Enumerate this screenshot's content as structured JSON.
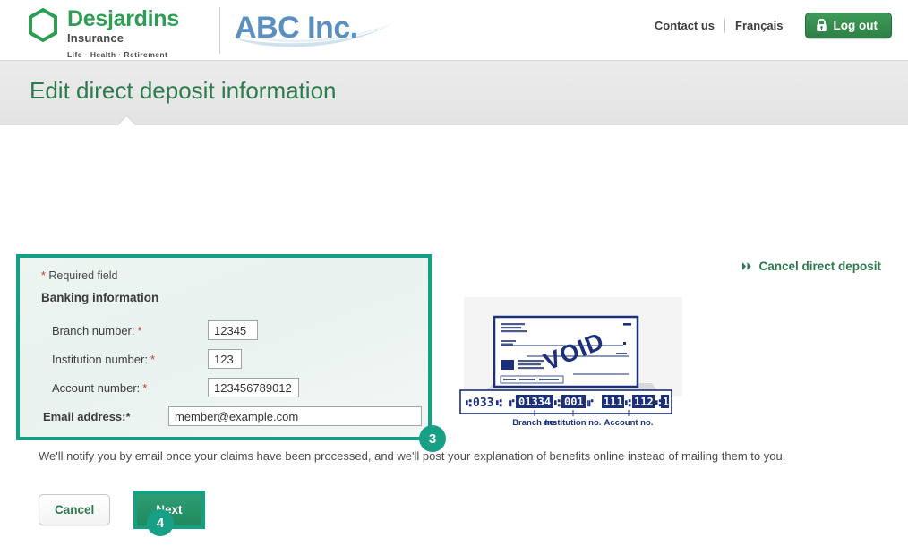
{
  "header": {
    "desjardins": {
      "name": "Desjardins",
      "subtitle": "Insurance",
      "tagline": "Life · Health · Retirement",
      "logo_icon": "hexagon-icon",
      "logo_color": "#2e9e54"
    },
    "client_logo": {
      "text": "ABC Inc.",
      "color": "#5a8fc0"
    },
    "links": [
      {
        "label": "Contact us",
        "name": "contact-us-link"
      },
      {
        "label": "Français",
        "name": "francais-link"
      }
    ],
    "logout": {
      "label": "Log out",
      "icon": "lock-icon",
      "color": "#2e8047"
    }
  },
  "page": {
    "title": "Edit direct deposit information",
    "title_color": "#2d7a4d"
  },
  "cancel_deposit": {
    "label": "Cancel direct deposit",
    "icon": "double-chevron-right-icon"
  },
  "form": {
    "highlight_color": "#14a085",
    "required_note_star": "*",
    "required_note": "Required field",
    "section_heading": "Banking information",
    "fields": [
      {
        "label": "Branch number:",
        "required": "*",
        "value": "12345",
        "name": "branch-number-input",
        "bold": false
      },
      {
        "label": "Institution number:",
        "required": "*",
        "value": "123",
        "name": "institution-number-input",
        "bold": false
      },
      {
        "label": "Account number:",
        "required": "*",
        "value": "123456789012",
        "name": "account-number-input",
        "bold": false
      },
      {
        "label": "Email address:",
        "required": "*",
        "value": "member@example.com",
        "name": "email-address-input",
        "bold": true
      }
    ]
  },
  "cheque": {
    "void_stamp": "VOID",
    "micr": {
      "cheque_no": "033",
      "branch": "01334",
      "institution": "001",
      "account_part1": "111",
      "account_part2": "112",
      "account_part3": "1"
    },
    "labels": {
      "branch": "Branch no.",
      "institution": "Institution no.",
      "account": "Account no."
    }
  },
  "notice": "We'll notify you by email once your claims have been processed, and we'll post your explanation of benefits online instead of mailing them to you.",
  "buttons": {
    "cancel": "Cancel",
    "next": "Next"
  },
  "badges": {
    "step3": "3",
    "step4": "4",
    "color": "#18a086"
  }
}
